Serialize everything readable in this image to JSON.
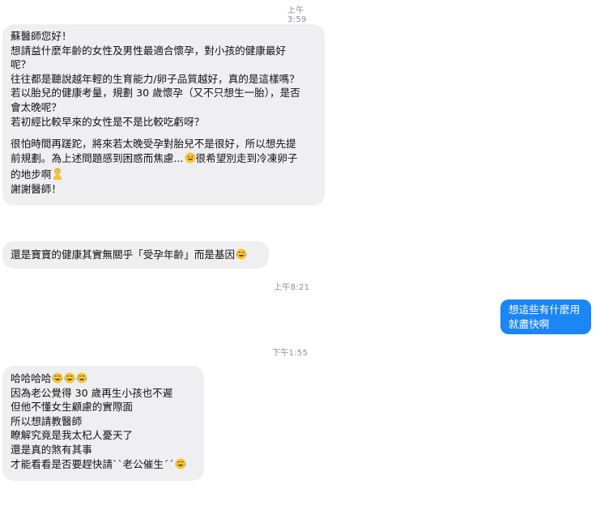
{
  "timestamps": {
    "t1": "上午3:59",
    "t2": "上午8:21",
    "t3": "下午1:55"
  },
  "messages": {
    "m1": {
      "lines": [
        "蘇醫師您好！",
        "想請益什麼年齡的女性及男性最適合懷孕，對小孩的健康最好",
        "呢？",
        "往往都是聽說越年輕的生育能力/卵子品質越好，真的是這樣嗎？",
        "若以胎兒的健康考量，規劃 30 歲懷孕（又不只想生一胎），是否",
        "會太晚呢？",
        "若初經比較早來的女性是不是比較吃虧呀？",
        "很怕時間再蹉跎，將來若太晚受孕對胎兒不是很好，所以想先提",
        "前規劃。為上述問題感到困惑而焦慮...",
        "很希望別走到冷凍卵子",
        "的地步啊",
        "謝謝醫師！"
      ]
    },
    "m2": {
      "text": "還是寶寶的健康其實無關乎「受孕年齡」而是基因"
    },
    "m3": {
      "lines": [
        "想這些有什麼用",
        "就盡快啊"
      ]
    },
    "m4": {
      "lines": [
        "哈哈哈哈",
        "因為老公覺得 30 歲再生小孩也不遲",
        "但他不懂女生顧慮的實際面",
        "所以想請教醫師",
        "瞭解究竟是我太杞人憂天了",
        "還是真的煞有其事",
        "才能看看是否要趕快請``老公催生´´"
      ]
    }
  },
  "icons": {
    "laugh": "face-with-tears-of-joy-icon",
    "sweat": "grinning-sweat-icon",
    "person": "person-icon"
  },
  "colors": {
    "incoming_bubble": "#efeff2",
    "outgoing_bubble": "#1b86f5",
    "timestamp": "#8e8e93"
  }
}
